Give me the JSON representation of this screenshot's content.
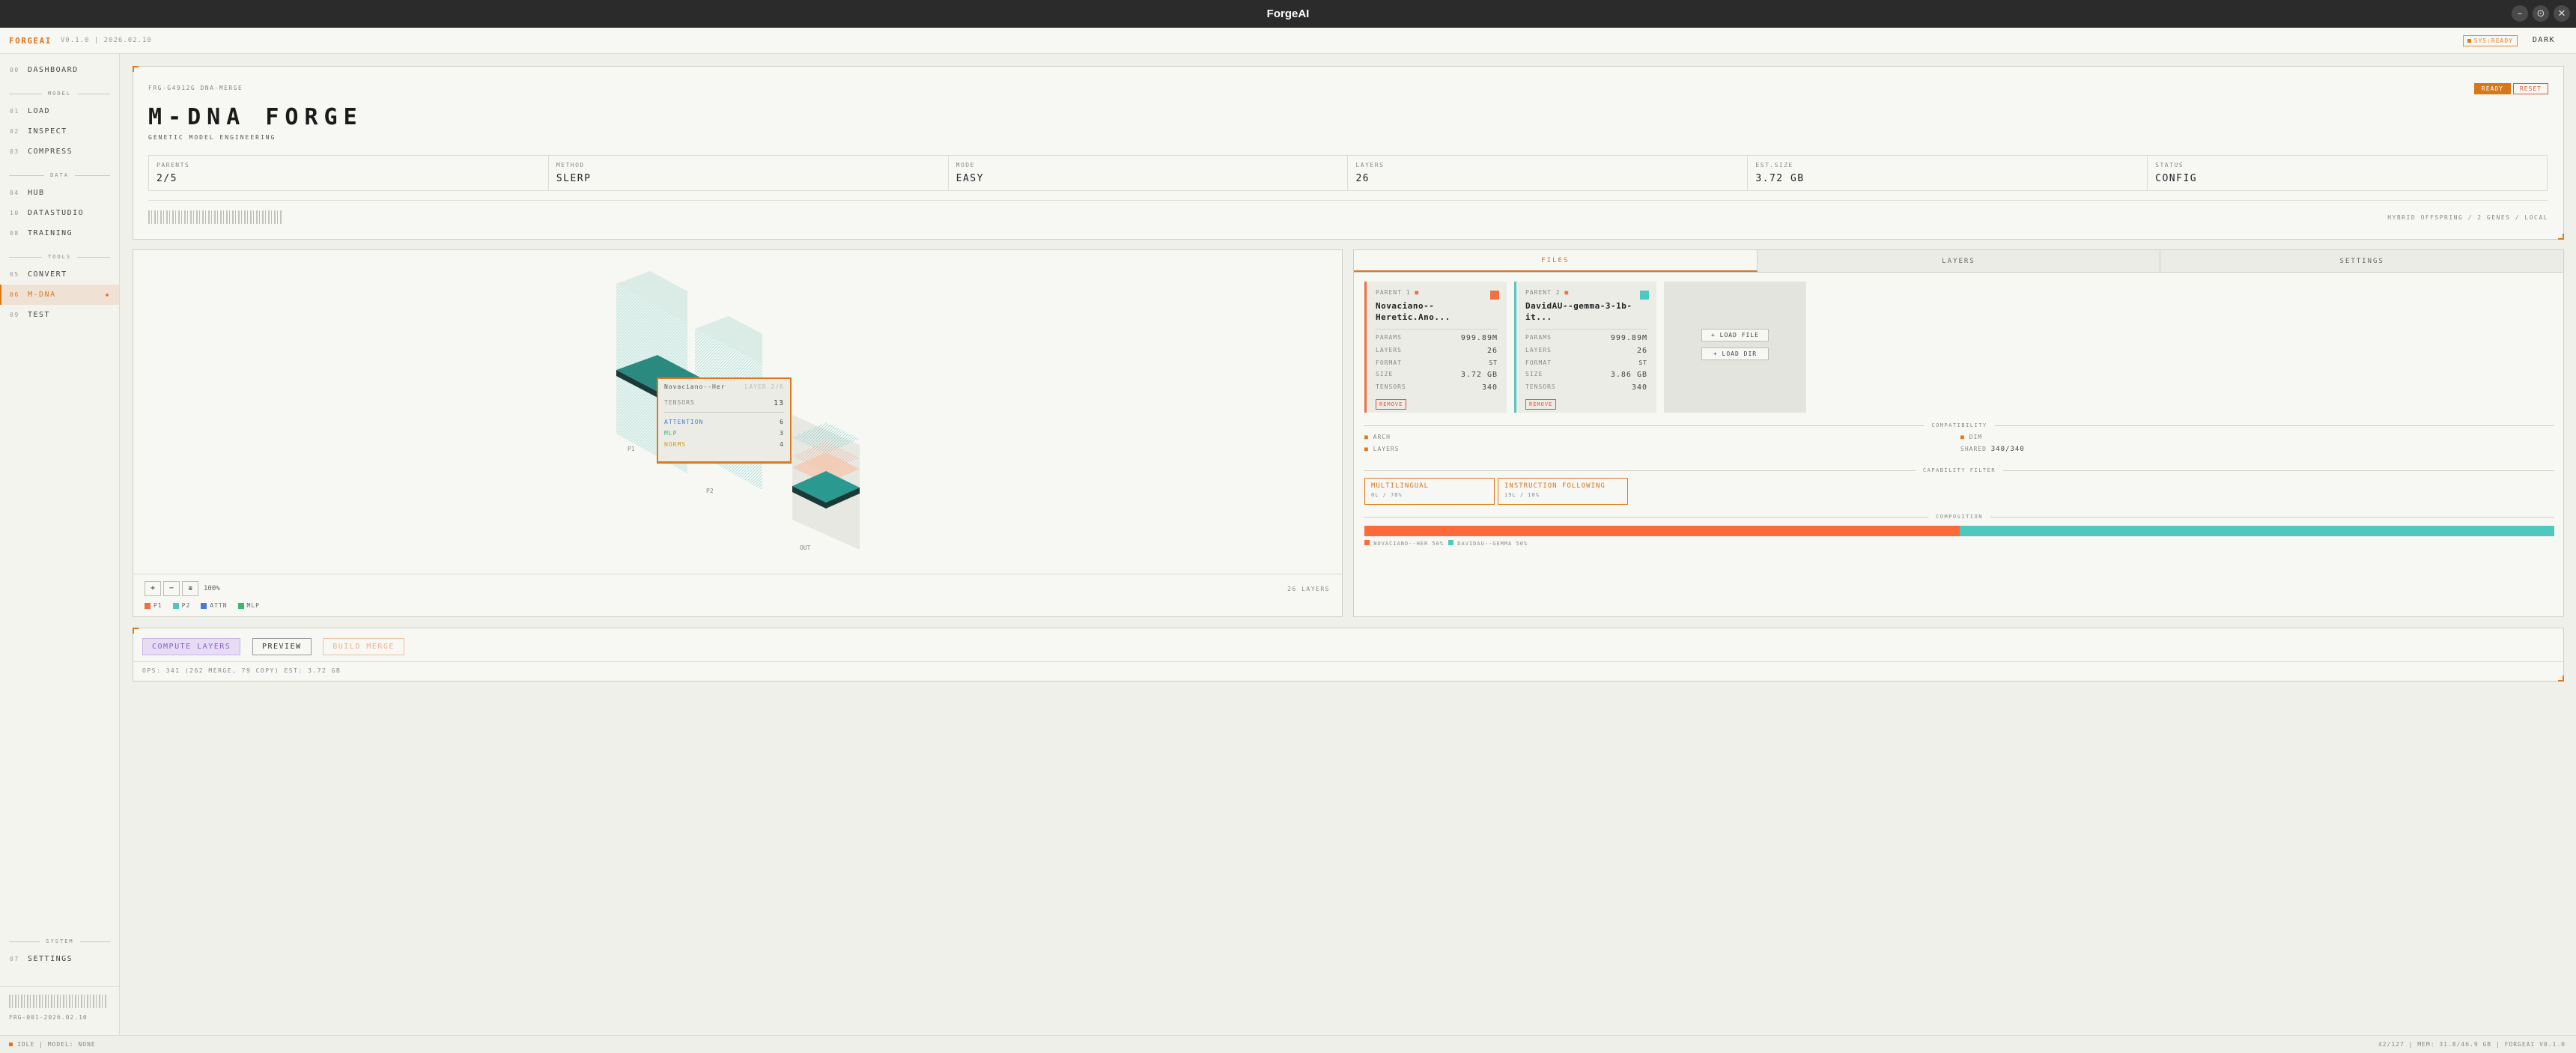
{
  "window": {
    "title": "ForgeAI",
    "controls": [
      "–",
      "⊙",
      "✕"
    ]
  },
  "topbar": {
    "brand": "FORGEAI",
    "version": "V0.1.0 | 2026.02.10",
    "sys_ready": "SYS:READY",
    "theme": "DARK"
  },
  "sidebar": {
    "items": [
      {
        "num": "00",
        "label": "DASHBOARD"
      },
      {
        "group": "MODEL"
      },
      {
        "num": "01",
        "label": "LOAD"
      },
      {
        "num": "02",
        "label": "INSPECT"
      },
      {
        "num": "03",
        "label": "COMPRESS"
      },
      {
        "group": "DATA"
      },
      {
        "num": "04",
        "label": "HUB"
      },
      {
        "num": "10",
        "label": "DATASTUDIO"
      },
      {
        "num": "08",
        "label": "TRAINING"
      },
      {
        "group": "TOOLS"
      },
      {
        "num": "05",
        "label": "CONVERT"
      },
      {
        "num": "06",
        "label": "M-DNA",
        "active": true
      },
      {
        "num": "09",
        "label": "TEST"
      }
    ],
    "system_group": "SYSTEM",
    "settings": {
      "num": "07",
      "label": "SETTINGS"
    },
    "footer_id": "FRG-001-2026.02.10"
  },
  "header": {
    "crumb": "FRG-G4912G  DNA-MERGE",
    "title": "M-DNA FORGE",
    "subtitle": "GENETIC MODEL ENGINEERING",
    "ready": "READY",
    "reset": "RESET",
    "stats": [
      {
        "k": "PARENTS",
        "v": "2/5"
      },
      {
        "k": "METHOD",
        "v": "SLERP"
      },
      {
        "k": "MODE",
        "v": "EASY"
      },
      {
        "k": "LAYERS",
        "v": "26"
      },
      {
        "k": "EST.SIZE",
        "v": "3.72 GB"
      },
      {
        "k": "STATUS",
        "v": "CONFIG"
      }
    ],
    "hybrid": "HYBRID OFFSPRING / 2 GENES / LOCAL"
  },
  "viz": {
    "labels": {
      "p1": "P1",
      "p2": "P2",
      "out": "OUT"
    },
    "tooltip": {
      "name": "Novaciano--Her",
      "hint": "LAYER 2/6",
      "tensors_label": "TENSORS",
      "tensors": "13",
      "attention_label": "ATTENTION",
      "attention": "6",
      "mlp_label": "MLP",
      "mlp": "3",
      "norms_label": "NORMS",
      "norms": "4"
    },
    "zoom": "100%",
    "layers": "26 LAYERS",
    "legend": [
      {
        "label": "P1",
        "color": "#f07040"
      },
      {
        "label": "P2",
        "color": "#4fc8c0"
      },
      {
        "label": "ATTN",
        "color": "#4a7ad8"
      },
      {
        "label": "MLP",
        "color": "#38b870"
      }
    ]
  },
  "files": {
    "tabs": [
      "FILES",
      "LAYERS",
      "SETTINGS"
    ],
    "parents": [
      {
        "label": "PARENT 1",
        "name": "Novaciano--Heretic.Ano...",
        "params": "999.89M",
        "layers": "26",
        "format": "ST",
        "size": "3.72 GB",
        "tensors": "340",
        "remove": "REMOVE",
        "color": "#f07040"
      },
      {
        "label": "PARENT 2",
        "name": "DavidAU--gemma-3-1b-it...",
        "params": "999.89M",
        "layers": "26",
        "format": "ST",
        "size": "3.86 GB",
        "tensors": "340",
        "remove": "REMOVE",
        "color": "#4fc8c0"
      }
    ],
    "keys": {
      "params": "PARAMS",
      "layers": "LAYERS",
      "format": "FORMAT",
      "size": "SIZE",
      "tensors": "TENSORS"
    },
    "load_file": "+ LOAD FILE",
    "load_dir": "+ LOAD DIR",
    "compat_title": "COMPATIBILITY",
    "compat": {
      "arch": "ARCH",
      "dim": "DIM",
      "layers": "LAYERS",
      "shared_label": "SHARED",
      "shared": "340/340"
    },
    "cap_title": "CAPABILITY FILTER",
    "caps": [
      {
        "name": "MULTILINGUAL",
        "sub": "0L / 78%"
      },
      {
        "name": "INSTRUCTION FOLLOWING",
        "sub": "19L / 10%"
      }
    ],
    "comp_title": "COMPOSITION",
    "composition": [
      {
        "name": "NOVACIANO--HER 50%",
        "fraction": 0.5,
        "color": "#ff6a3a"
      },
      {
        "name": "DAVIDAU--GEMMA 50%",
        "fraction": 0.5,
        "color": "#4fc8c0"
      }
    ]
  },
  "actions": {
    "compute": "COMPUTE LAYERS",
    "preview": "PREVIEW",
    "build": "BUILD MERGE",
    "summary": "OPS: 341 (262 MERGE, 79 COPY)  EST: 3.72 GB"
  },
  "status": {
    "left": "IDLE | MODEL: NONE",
    "right": "42/127 | MEM: 31.8/46.9 GB | FORGEAI V0.1.0"
  }
}
